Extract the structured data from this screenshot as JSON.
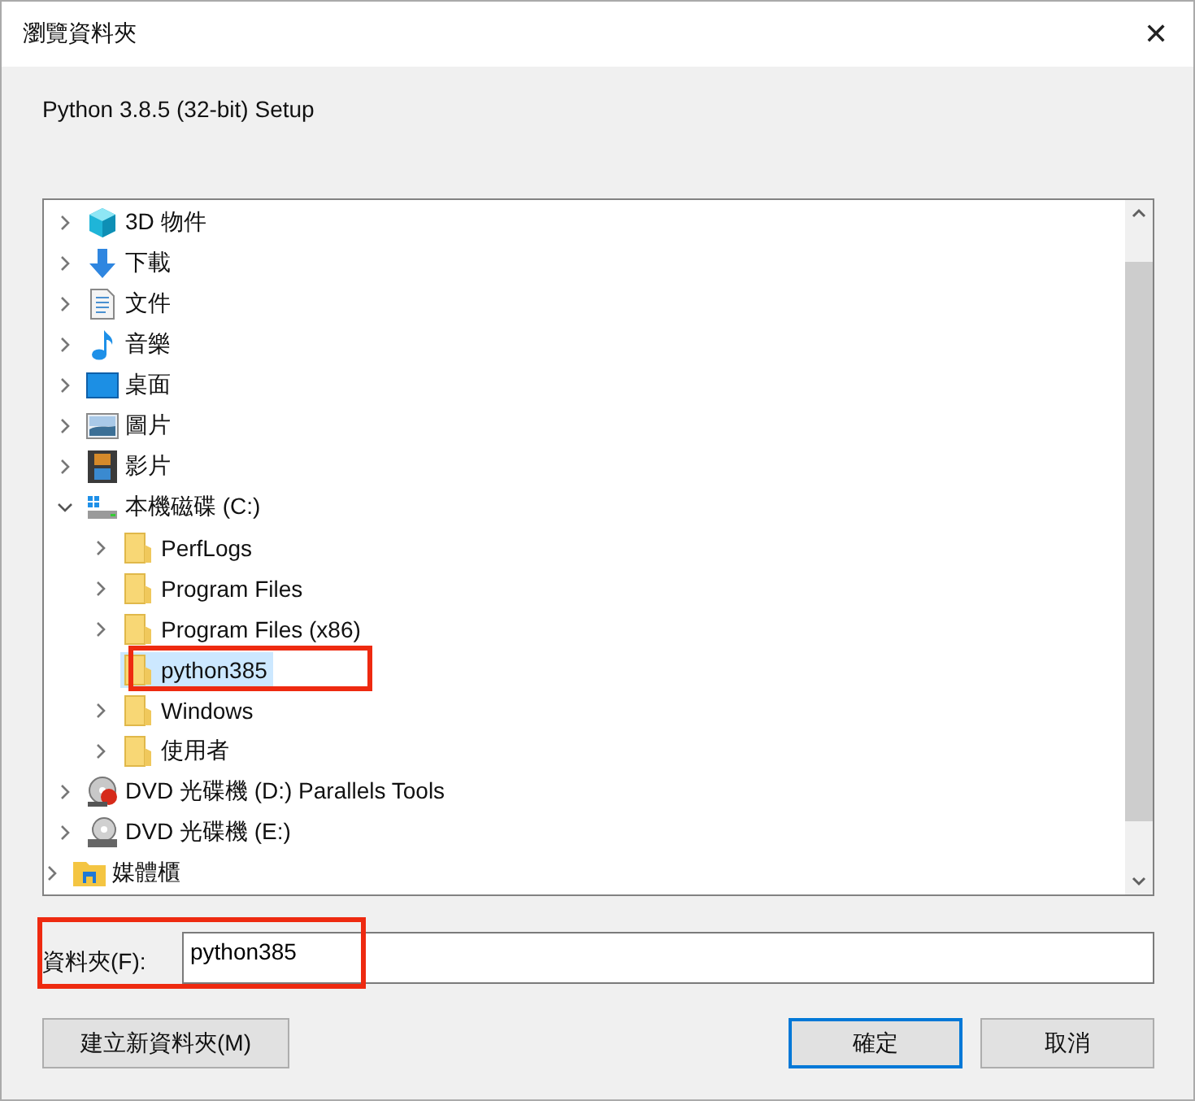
{
  "window": {
    "title": "瀏覽資料夾",
    "close": "✕"
  },
  "description": "Python 3.8.5 (32-bit) Setup",
  "tree": {
    "items": [
      {
        "children": [
          {
            "label": "3D 物件",
            "kind": "cube",
            "expandable": true,
            "expanded": false,
            "selected": false
          },
          {
            "label": "下載",
            "kind": "download",
            "expandable": true,
            "expanded": false,
            "selected": false
          },
          {
            "label": "文件",
            "kind": "document",
            "expandable": true,
            "expanded": false,
            "selected": false
          },
          {
            "label": "音樂",
            "kind": "music",
            "expandable": true,
            "expanded": false,
            "selected": false
          },
          {
            "label": "桌面",
            "kind": "desktop",
            "expandable": true,
            "expanded": false,
            "selected": false
          },
          {
            "label": "圖片",
            "kind": "pictures",
            "expandable": true,
            "expanded": false,
            "selected": false
          },
          {
            "label": "影片",
            "kind": "video",
            "expandable": true,
            "expanded": false,
            "selected": false
          },
          {
            "label": "本機磁碟 (C:)",
            "kind": "drive",
            "expandable": true,
            "expanded": true,
            "selected": false,
            "children": [
              {
                "label": "PerfLogs",
                "kind": "folder",
                "expandable": true,
                "expanded": false,
                "selected": false
              },
              {
                "label": "Program Files",
                "kind": "folder",
                "expandable": true,
                "expanded": false,
                "selected": false
              },
              {
                "label": "Program Files (x86)",
                "kind": "folder",
                "expandable": true,
                "expanded": false,
                "selected": false
              },
              {
                "label": "python385",
                "kind": "folder",
                "expandable": false,
                "selected": true,
                "annotated": true
              },
              {
                "label": "Windows",
                "kind": "folder",
                "expandable": true,
                "expanded": false,
                "selected": false
              },
              {
                "label": "使用者",
                "kind": "folder",
                "expandable": true,
                "expanded": false,
                "selected": false
              }
            ]
          },
          {
            "label": "DVD 光碟機 (D:) Parallels Tools",
            "kind": "dvd-app",
            "expandable": true,
            "expanded": false,
            "selected": false
          },
          {
            "label": "DVD 光碟機 (E:)",
            "kind": "dvd",
            "expandable": true,
            "expanded": false,
            "selected": false
          }
        ]
      },
      {
        "label": "媒體櫃",
        "kind": "library",
        "expandable": true,
        "expanded": false,
        "selected": false
      }
    ]
  },
  "folder_field": {
    "label": "資料夾(F):",
    "value": "python385",
    "annotated": true
  },
  "buttons": [
    {
      "label": "建立新資料夾(M)",
      "default": false
    },
    {
      "label": "確定",
      "default": true
    },
    {
      "label": "取消",
      "default": false
    }
  ]
}
